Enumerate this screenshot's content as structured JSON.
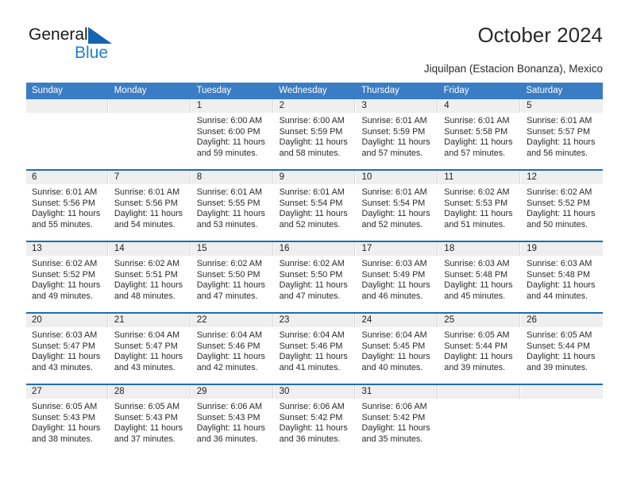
{
  "logo": {
    "word1": "General",
    "word2": "Blue",
    "icon": "blue-triangle",
    "color_dark": "#1a1a1a",
    "color_blue": "#1e7fd0"
  },
  "header": {
    "title": "October 2024",
    "subtitle": "Jiquilpan (Estacion Bonanza), Mexico"
  },
  "theme": {
    "header_blue": "#3b7dc4",
    "separator_blue": "#1f6cb5",
    "daynum_band": "#efefef"
  },
  "calendar": {
    "weekdays": [
      "Sunday",
      "Monday",
      "Tuesday",
      "Wednesday",
      "Thursday",
      "Friday",
      "Saturday"
    ],
    "weeks": [
      [
        {
          "day": "",
          "empty": true
        },
        {
          "day": "",
          "empty": true
        },
        {
          "day": "1",
          "sunrise": "Sunrise: 6:00 AM",
          "sunset": "Sunset: 6:00 PM",
          "daylight1": "Daylight: 11 hours",
          "daylight2": "and 59 minutes."
        },
        {
          "day": "2",
          "sunrise": "Sunrise: 6:00 AM",
          "sunset": "Sunset: 5:59 PM",
          "daylight1": "Daylight: 11 hours",
          "daylight2": "and 58 minutes."
        },
        {
          "day": "3",
          "sunrise": "Sunrise: 6:01 AM",
          "sunset": "Sunset: 5:59 PM",
          "daylight1": "Daylight: 11 hours",
          "daylight2": "and 57 minutes."
        },
        {
          "day": "4",
          "sunrise": "Sunrise: 6:01 AM",
          "sunset": "Sunset: 5:58 PM",
          "daylight1": "Daylight: 11 hours",
          "daylight2": "and 57 minutes."
        },
        {
          "day": "5",
          "sunrise": "Sunrise: 6:01 AM",
          "sunset": "Sunset: 5:57 PM",
          "daylight1": "Daylight: 11 hours",
          "daylight2": "and 56 minutes."
        }
      ],
      [
        {
          "day": "6",
          "sunrise": "Sunrise: 6:01 AM",
          "sunset": "Sunset: 5:56 PM",
          "daylight1": "Daylight: 11 hours",
          "daylight2": "and 55 minutes."
        },
        {
          "day": "7",
          "sunrise": "Sunrise: 6:01 AM",
          "sunset": "Sunset: 5:56 PM",
          "daylight1": "Daylight: 11 hours",
          "daylight2": "and 54 minutes."
        },
        {
          "day": "8",
          "sunrise": "Sunrise: 6:01 AM",
          "sunset": "Sunset: 5:55 PM",
          "daylight1": "Daylight: 11 hours",
          "daylight2": "and 53 minutes."
        },
        {
          "day": "9",
          "sunrise": "Sunrise: 6:01 AM",
          "sunset": "Sunset: 5:54 PM",
          "daylight1": "Daylight: 11 hours",
          "daylight2": "and 52 minutes."
        },
        {
          "day": "10",
          "sunrise": "Sunrise: 6:01 AM",
          "sunset": "Sunset: 5:54 PM",
          "daylight1": "Daylight: 11 hours",
          "daylight2": "and 52 minutes."
        },
        {
          "day": "11",
          "sunrise": "Sunrise: 6:02 AM",
          "sunset": "Sunset: 5:53 PM",
          "daylight1": "Daylight: 11 hours",
          "daylight2": "and 51 minutes."
        },
        {
          "day": "12",
          "sunrise": "Sunrise: 6:02 AM",
          "sunset": "Sunset: 5:52 PM",
          "daylight1": "Daylight: 11 hours",
          "daylight2": "and 50 minutes."
        }
      ],
      [
        {
          "day": "13",
          "sunrise": "Sunrise: 6:02 AM",
          "sunset": "Sunset: 5:52 PM",
          "daylight1": "Daylight: 11 hours",
          "daylight2": "and 49 minutes."
        },
        {
          "day": "14",
          "sunrise": "Sunrise: 6:02 AM",
          "sunset": "Sunset: 5:51 PM",
          "daylight1": "Daylight: 11 hours",
          "daylight2": "and 48 minutes."
        },
        {
          "day": "15",
          "sunrise": "Sunrise: 6:02 AM",
          "sunset": "Sunset: 5:50 PM",
          "daylight1": "Daylight: 11 hours",
          "daylight2": "and 47 minutes."
        },
        {
          "day": "16",
          "sunrise": "Sunrise: 6:02 AM",
          "sunset": "Sunset: 5:50 PM",
          "daylight1": "Daylight: 11 hours",
          "daylight2": "and 47 minutes."
        },
        {
          "day": "17",
          "sunrise": "Sunrise: 6:03 AM",
          "sunset": "Sunset: 5:49 PM",
          "daylight1": "Daylight: 11 hours",
          "daylight2": "and 46 minutes."
        },
        {
          "day": "18",
          "sunrise": "Sunrise: 6:03 AM",
          "sunset": "Sunset: 5:48 PM",
          "daylight1": "Daylight: 11 hours",
          "daylight2": "and 45 minutes."
        },
        {
          "day": "19",
          "sunrise": "Sunrise: 6:03 AM",
          "sunset": "Sunset: 5:48 PM",
          "daylight1": "Daylight: 11 hours",
          "daylight2": "and 44 minutes."
        }
      ],
      [
        {
          "day": "20",
          "sunrise": "Sunrise: 6:03 AM",
          "sunset": "Sunset: 5:47 PM",
          "daylight1": "Daylight: 11 hours",
          "daylight2": "and 43 minutes."
        },
        {
          "day": "21",
          "sunrise": "Sunrise: 6:04 AM",
          "sunset": "Sunset: 5:47 PM",
          "daylight1": "Daylight: 11 hours",
          "daylight2": "and 43 minutes."
        },
        {
          "day": "22",
          "sunrise": "Sunrise: 6:04 AM",
          "sunset": "Sunset: 5:46 PM",
          "daylight1": "Daylight: 11 hours",
          "daylight2": "and 42 minutes."
        },
        {
          "day": "23",
          "sunrise": "Sunrise: 6:04 AM",
          "sunset": "Sunset: 5:46 PM",
          "daylight1": "Daylight: 11 hours",
          "daylight2": "and 41 minutes."
        },
        {
          "day": "24",
          "sunrise": "Sunrise: 6:04 AM",
          "sunset": "Sunset: 5:45 PM",
          "daylight1": "Daylight: 11 hours",
          "daylight2": "and 40 minutes."
        },
        {
          "day": "25",
          "sunrise": "Sunrise: 6:05 AM",
          "sunset": "Sunset: 5:44 PM",
          "daylight1": "Daylight: 11 hours",
          "daylight2": "and 39 minutes."
        },
        {
          "day": "26",
          "sunrise": "Sunrise: 6:05 AM",
          "sunset": "Sunset: 5:44 PM",
          "daylight1": "Daylight: 11 hours",
          "daylight2": "and 39 minutes."
        }
      ],
      [
        {
          "day": "27",
          "sunrise": "Sunrise: 6:05 AM",
          "sunset": "Sunset: 5:43 PM",
          "daylight1": "Daylight: 11 hours",
          "daylight2": "and 38 minutes."
        },
        {
          "day": "28",
          "sunrise": "Sunrise: 6:05 AM",
          "sunset": "Sunset: 5:43 PM",
          "daylight1": "Daylight: 11 hours",
          "daylight2": "and 37 minutes."
        },
        {
          "day": "29",
          "sunrise": "Sunrise: 6:06 AM",
          "sunset": "Sunset: 5:43 PM",
          "daylight1": "Daylight: 11 hours",
          "daylight2": "and 36 minutes."
        },
        {
          "day": "30",
          "sunrise": "Sunrise: 6:06 AM",
          "sunset": "Sunset: 5:42 PM",
          "daylight1": "Daylight: 11 hours",
          "daylight2": "and 36 minutes."
        },
        {
          "day": "31",
          "sunrise": "Sunrise: 6:06 AM",
          "sunset": "Sunset: 5:42 PM",
          "daylight1": "Daylight: 11 hours",
          "daylight2": "and 35 minutes."
        },
        {
          "day": "",
          "empty": true
        },
        {
          "day": "",
          "empty": true
        }
      ]
    ]
  }
}
